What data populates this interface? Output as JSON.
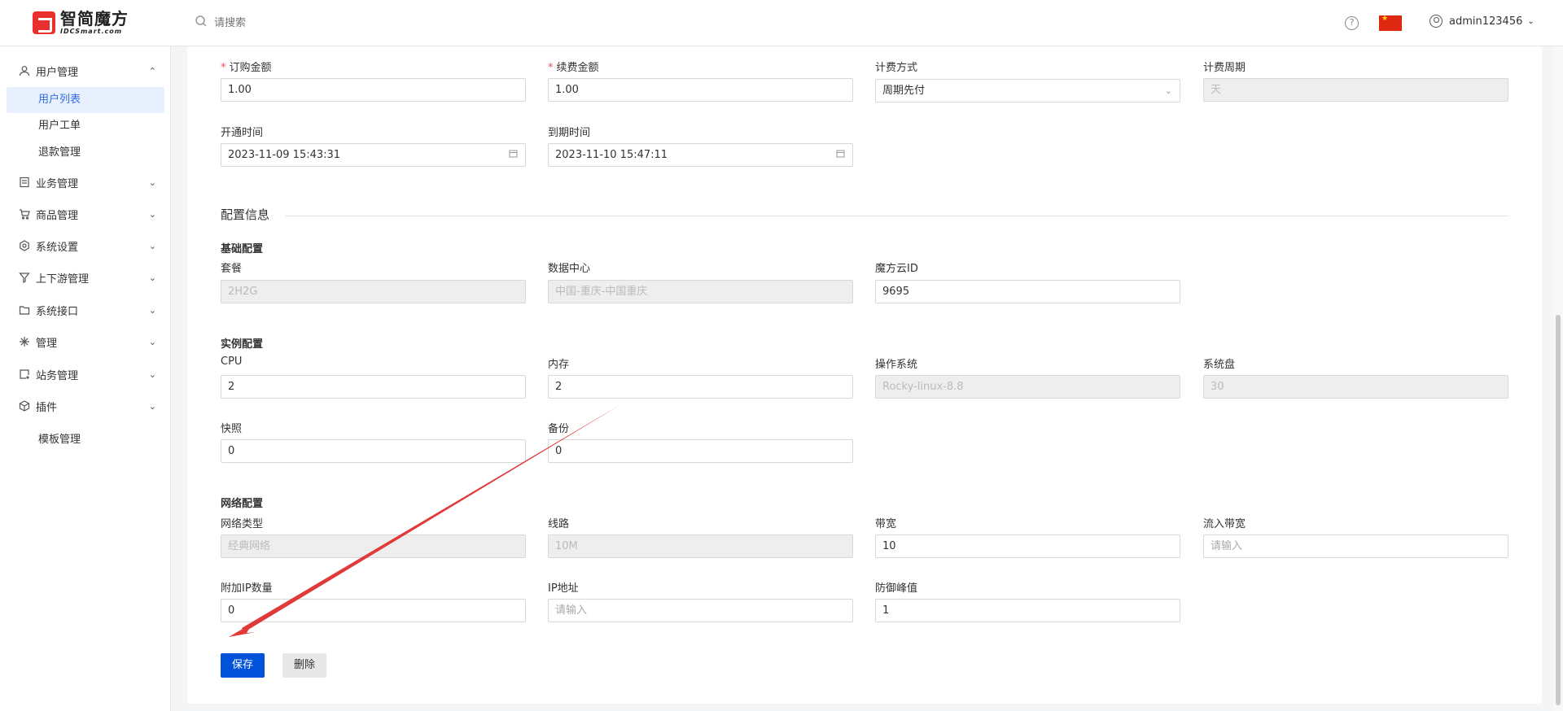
{
  "header": {
    "logo_cn": "智简魔方",
    "logo_en": "IDCSmart.com",
    "search_placeholder": "请搜索",
    "help": "?",
    "username": "admin123456"
  },
  "sidebar": {
    "user_mgmt": "用户管理",
    "sub": [
      "用户列表",
      "用户工单",
      "退款管理"
    ],
    "items": [
      "业务管理",
      "商品管理",
      "系统设置",
      "上下游管理",
      "系统接口",
      "管理",
      "站务管理",
      "插件"
    ],
    "template_mgmt": "模板管理"
  },
  "billing": {
    "order_amount_label": "订购金额",
    "order_amount": "1.00",
    "renew_amount_label": "续费金额",
    "renew_amount": "1.00",
    "billing_method_label": "计费方式",
    "billing_method": "周期先付",
    "billing_cycle_label": "计费周期",
    "billing_cycle": "天",
    "open_time_label": "开通时间",
    "open_time": "2023-11-09 15:43:31",
    "expire_time_label": "到期时间",
    "expire_time": "2023-11-10 15:47:11"
  },
  "config": {
    "section_title": "配置信息",
    "basic_title": "基础配置",
    "package_label": "套餐",
    "package": "2H2G",
    "dc_label": "数据中心",
    "dc": "中国-重庆-中国重庆",
    "cloud_id_label": "魔方云ID",
    "cloud_id": "9695",
    "instance_title": "实例配置",
    "cpu_label": "CPU",
    "cpu": "2",
    "mem_label": "内存",
    "mem": "2",
    "os_label": "操作系统",
    "os": "Rocky-linux-8.8",
    "disk_label": "系统盘",
    "disk": "30",
    "snapshot_label": "快照",
    "snapshot": "0",
    "backup_label": "备份",
    "backup": "0",
    "network_title": "网络配置",
    "net_type_label": "网络类型",
    "net_type": "经典网络",
    "line_label": "线路",
    "line": "10M",
    "bw_label": "带宽",
    "bw": "10",
    "in_bw_label": "流入带宽",
    "in_bw_placeholder": "请输入",
    "extra_ip_label": "附加IP数量",
    "extra_ip": "0",
    "ip_label": "IP地址",
    "ip_placeholder": "请输入",
    "ddos_label": "防御峰值",
    "ddos": "1"
  },
  "actions": {
    "save": "保存",
    "delete": "删除"
  },
  "colors": {
    "primary": "#0052d9",
    "annotation_arrow": "#e03a3a"
  }
}
